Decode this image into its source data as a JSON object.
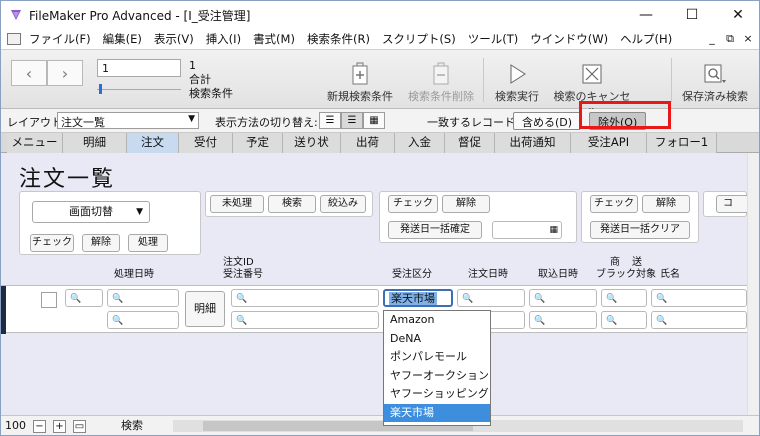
{
  "window": {
    "title": "FileMaker Pro Advanced - [I_受注管理]"
  },
  "menu": [
    "ファイル(F)",
    "編集(E)",
    "表示(V)",
    "挿入(I)",
    "書式(M)",
    "検索条件(R)",
    "スクリプト(S)",
    "ツール(T)",
    "ウインドウ(W)",
    "ヘルプ(H)"
  ],
  "toolbar": {
    "record_value": "1",
    "record_count": "1",
    "record_total_label": "合計",
    "mode_label": "検索条件",
    "new_find": "新規検索条件",
    "delete_find": "検索条件削除",
    "perform_find": "検索実行",
    "cancel_find": "検索のキャンセル",
    "saved_finds": "保存済み検索"
  },
  "layoutbar": {
    "layout_label": "レイアウト:",
    "layout_value": "注文一覧",
    "view_label": "表示方法の切り替え:",
    "match_label": "一致するレコード:",
    "include_btn": "含める(D)",
    "omit_btn": "除外(O)"
  },
  "tabs": [
    "メニュー",
    "明細",
    "注文",
    "受付",
    "予定",
    "送り状",
    "出荷",
    "入金",
    "督促",
    "出荷通知",
    "受注API",
    "フォロー1"
  ],
  "active_tab": "注文",
  "page": {
    "title": "注文一覧"
  },
  "buttons": {
    "screen_switch": "画面切替",
    "check1": "チェック",
    "clear1": "解除",
    "process": "処理",
    "unprocessed": "未処理",
    "search": "検索",
    "narrow": "絞込み",
    "check2": "チェック",
    "clear2": "解除",
    "ship_date_confirm": "発送日一括確定",
    "check3": "チェック",
    "clear3": "解除",
    "ship_date_clear": "発送日一括クリア",
    "cut": "コ",
    "detail": "明細"
  },
  "columns": {
    "process_datetime": "処理日時",
    "order_id_label": "注文ID",
    "order_no": "受注番号",
    "order_type": "受注区分",
    "order_datetime": "注文日時",
    "capture_datetime": "取込日時",
    "product": "商",
    "shipping": "送",
    "blacklist": "ブラック対象",
    "name": "氏名"
  },
  "find_fields": {
    "order_type_value": "楽天市場"
  },
  "dropdown": [
    "Amazon",
    "DeNA",
    "ポンパレモール",
    "ヤフーオークション",
    "ヤフーショッピング",
    "楽天市場"
  ],
  "dropdown_selected": "楽天市場",
  "status": {
    "zoom": "100",
    "mode": "検索"
  },
  "colors": {
    "tab_active": "#c8daf0",
    "accent": "#3d8fde",
    "highlight_box": "#e81818"
  }
}
